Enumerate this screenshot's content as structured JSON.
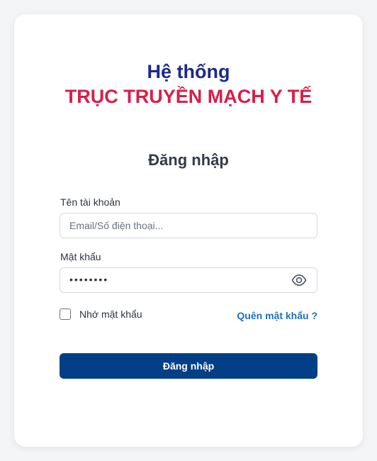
{
  "header": {
    "line1": "Hệ thống",
    "line2": "TRỤC TRUYỀN MẠCH Y TẾ"
  },
  "form": {
    "heading": "Đăng nhập",
    "username": {
      "label": "Tên tài khoản",
      "placeholder": "Email/Số điện thoại...",
      "value": ""
    },
    "password": {
      "label": "Mật khẩu",
      "masked_value": "••••••••",
      "toggle_icon": "eye-icon"
    },
    "remember_label": "Nhớ mật khẩu",
    "remember_checked": false,
    "forgot_label": "Quên mật khẩu ?",
    "submit_label": "Đăng nhập"
  },
  "colors": {
    "title_primary": "#1b2a8a",
    "title_accent": "#d71f49",
    "link": "#1f6fbf",
    "button": "#023f86"
  }
}
